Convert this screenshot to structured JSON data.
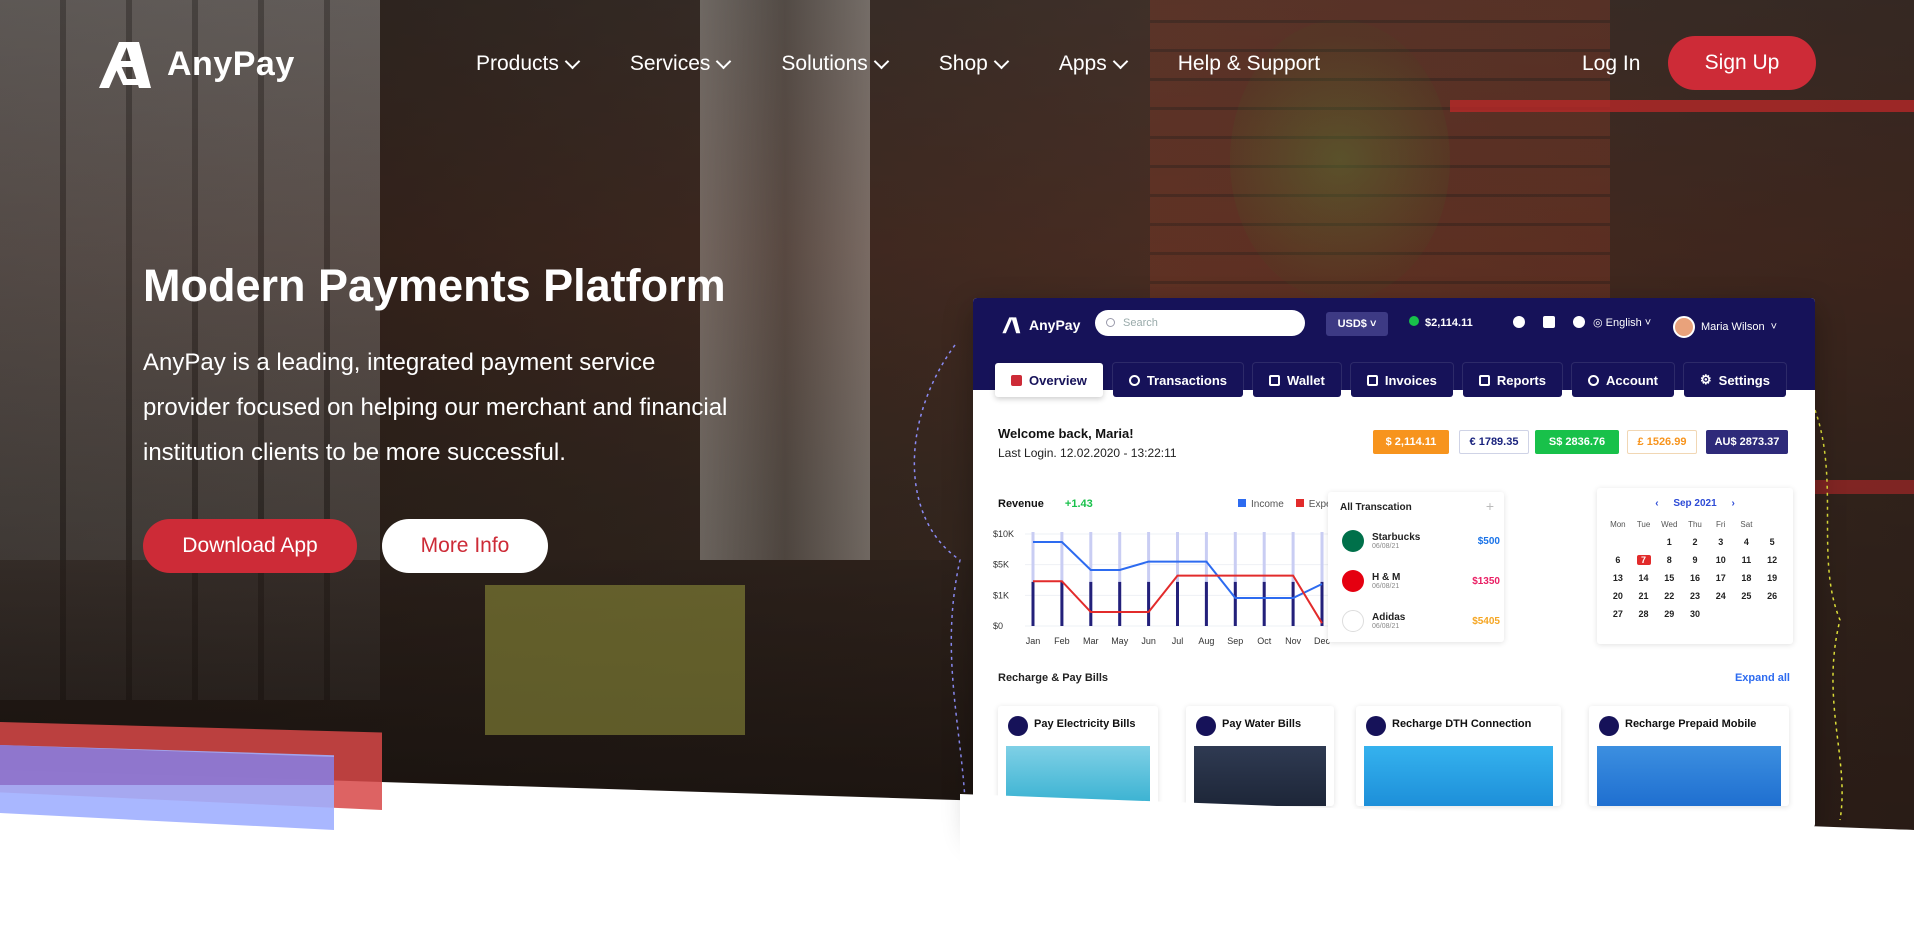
{
  "brand": {
    "name": "AnyPay"
  },
  "nav": {
    "items": [
      {
        "label": "Products",
        "has_dropdown": true
      },
      {
        "label": "Services",
        "has_dropdown": true
      },
      {
        "label": "Solutions",
        "has_dropdown": true
      },
      {
        "label": "Shop",
        "has_dropdown": true
      },
      {
        "label": "Apps",
        "has_dropdown": true
      },
      {
        "label": "Help & Support",
        "has_dropdown": false
      }
    ],
    "login": "Log In",
    "signup": "Sign Up"
  },
  "hero": {
    "title": "Modern Payments Platform",
    "description": "AnyPay is a leading, integrated payment service provider focused on helping our merchant and financial institution clients to be more successful.",
    "primary_button": "Download App",
    "secondary_button": "More Info"
  },
  "colors": {
    "accent": "#cd2b37",
    "dashboard_header": "#161259"
  },
  "dashboard": {
    "logo": "AnyPay",
    "search_placeholder": "Search",
    "currency": "USD$",
    "balance": "$2,114.11",
    "language": "English",
    "user": "Maria Wilson",
    "tabs": [
      "Overview",
      "Transactions",
      "Wallet",
      "Invoices",
      "Reports",
      "Account",
      "Settings"
    ],
    "welcome": "Welcome back, Maria!",
    "last_login": "Last Login. 12.02.2020 - 13:22:11",
    "currencies": [
      {
        "label": "$ 2,114.11",
        "bg": "#f7941d",
        "fg": "#ffffff"
      },
      {
        "label": "€ 1789.35",
        "bg": "#ffffff",
        "fg": "#1a237e"
      },
      {
        "label": "S$ 2836.76",
        "bg": "#18c14a",
        "fg": "#ffffff"
      },
      {
        "label": "£ 1526.99",
        "bg": "#ffffff",
        "fg": "#f7941d"
      },
      {
        "label": "AU$ 2873.37",
        "bg": "#2e2a7a",
        "fg": "#ffffff"
      }
    ],
    "revenue": {
      "title": "Revenue",
      "change": "+1.43",
      "legend_income": "Income",
      "legend_expenses": "Expenses"
    },
    "transactions": {
      "title": "All Transcation",
      "items": [
        {
          "name": "Starbucks",
          "date": "06/08/21",
          "amount": "$500",
          "color": "#1a73e8",
          "logo_color": "#00704a"
        },
        {
          "name": "H & M",
          "date": "06/08/21",
          "amount": "$1350",
          "color": "#e91e63",
          "logo_color": "#e50010"
        },
        {
          "name": "Adidas",
          "date": "06/08/21",
          "amount": "$5405",
          "color": "#f5a623",
          "logo_color": "#ffffff"
        }
      ]
    },
    "calendar": {
      "month": "Sep 2021",
      "weekdays": [
        "Mon",
        "Tue",
        "Wed",
        "Thu",
        "Fri",
        "Sat"
      ],
      "days": [
        "",
        "",
        "1",
        "2",
        "3",
        "4",
        "5",
        "6",
        "7",
        "8",
        "9",
        "10",
        "11",
        "12",
        "13",
        "14",
        "15",
        "16",
        "17",
        "18",
        "19",
        "20",
        "21",
        "22",
        "23",
        "24",
        "25",
        "26",
        "27",
        "28",
        "29",
        "30"
      ],
      "selected": "7"
    },
    "bills": {
      "title": "Recharge & Pay Bills",
      "expand": "Expand all",
      "items": [
        "Pay Electricity Bills",
        "Pay Water Bills",
        "Recharge DTH Connection",
        "Recharge Prepaid Mobile"
      ]
    }
  },
  "chart_data": {
    "type": "line",
    "title": "Revenue",
    "categories": [
      "Jan",
      "Feb",
      "Mar",
      "May",
      "Jun",
      "Jul",
      "Aug",
      "Sep",
      "Oct",
      "Nov",
      "Dec"
    ],
    "y_ticks": [
      "$10K",
      "$5K",
      "$1K",
      "$0"
    ],
    "series": [
      {
        "name": "Income",
        "color": "#2d6bf0",
        "values": [
          3,
          3,
          2,
          2,
          2.3,
          2.3,
          2.3,
          1,
          1,
          1,
          1.5
        ]
      },
      {
        "name": "Expenses",
        "color": "#e22b2b",
        "values": [
          1.6,
          1.6,
          0.5,
          0.5,
          0.5,
          1.8,
          1.8,
          1.8,
          1.8,
          1.8,
          0.1
        ]
      }
    ],
    "ylim": [
      0,
      3.5
    ]
  }
}
